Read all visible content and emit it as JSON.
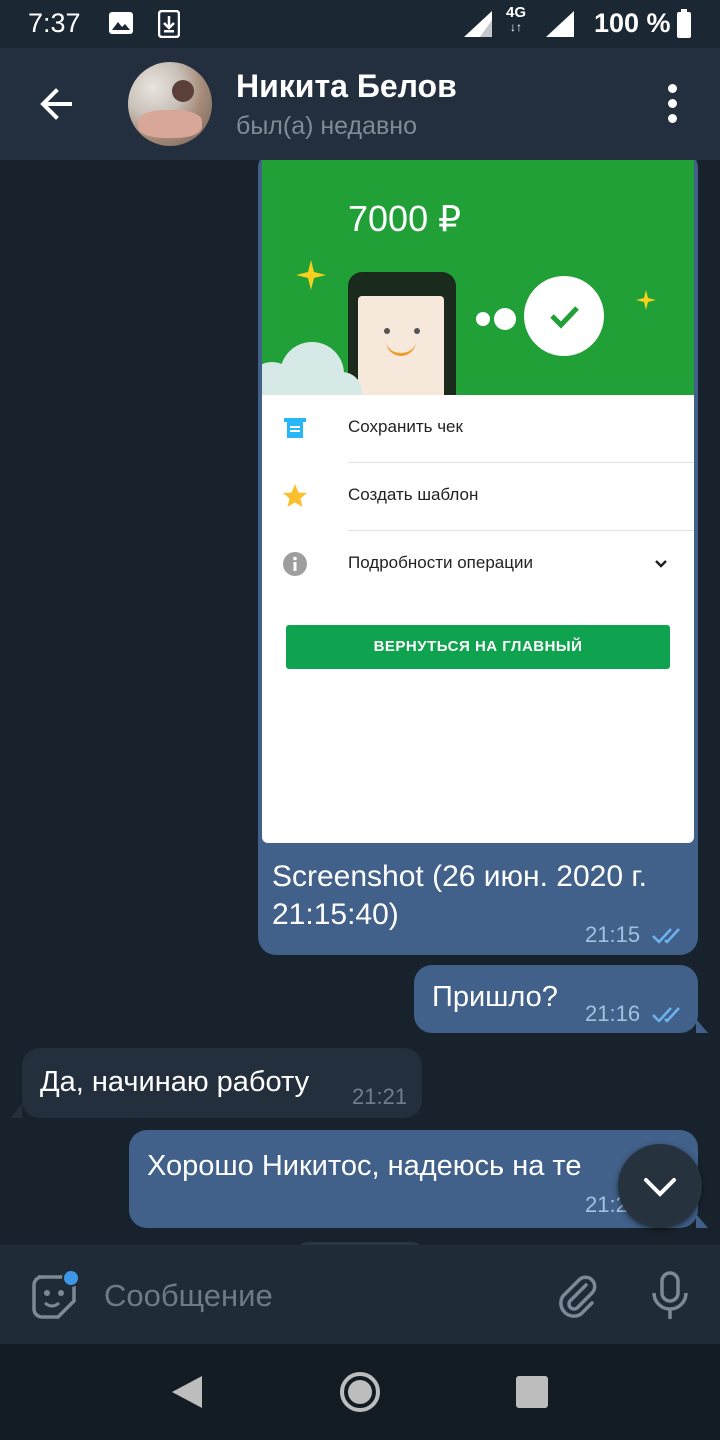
{
  "status_bar": {
    "time": "7:37",
    "network": "4G",
    "battery": "100 %"
  },
  "header": {
    "contact_name": "Никита Белов",
    "contact_status": "был(а) недавно"
  },
  "messages": {
    "image_message": {
      "screenshot": {
        "amount": "7000 ₽",
        "rows": [
          {
            "label": "Сохранить чек",
            "icon": "receipt-icon"
          },
          {
            "label": "Создать шаблон",
            "icon": "star-icon"
          },
          {
            "label": "Подробности операции",
            "icon": "info-icon"
          }
        ],
        "button": "ВЕРНУТЬСЯ НА ГЛАВНЫЙ"
      },
      "caption": "Screenshot (26 июн. 2020 г. 21:15:40)",
      "time": "21:15"
    },
    "msg2": {
      "text": "Пришло?",
      "time": "21:16"
    },
    "msg3": {
      "text": "Да, начинаю работу",
      "time": "21:21"
    },
    "msg4": {
      "text": "Хорошо Никитос, надеюсь на те",
      "time": "21:2"
    }
  },
  "input": {
    "placeholder": "Сообщение"
  },
  "colors": {
    "outgoing_bubble": "#41618a",
    "incoming_bubble": "#242f3d",
    "background": "#18222d",
    "accent": "#3e97e6"
  }
}
